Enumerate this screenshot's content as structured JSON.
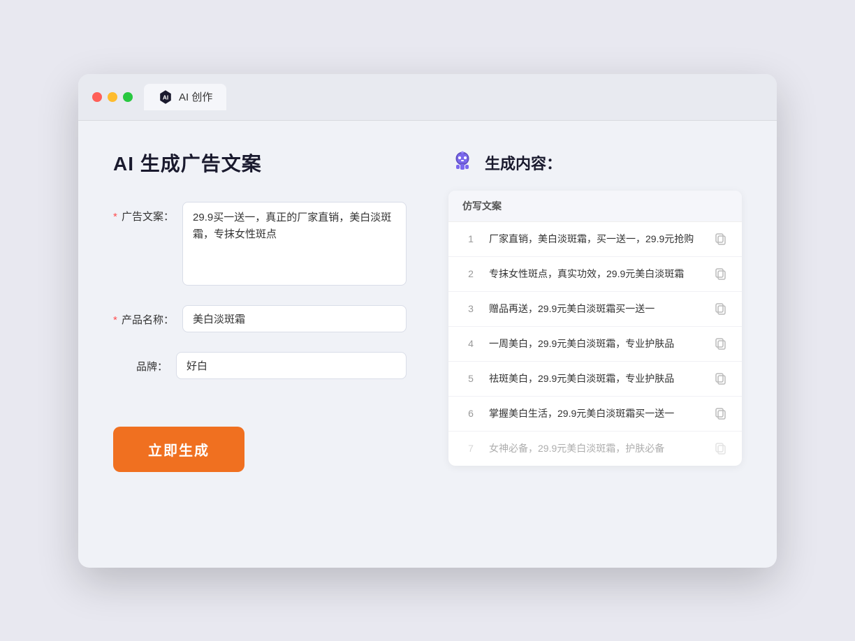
{
  "window": {
    "tab_label": "AI 创作",
    "traffic_lights": [
      "red",
      "yellow",
      "green"
    ]
  },
  "left_panel": {
    "title": "AI 生成广告文案",
    "fields": [
      {
        "label": "广告文案：",
        "required": true,
        "type": "textarea",
        "value": "29.9买一送一，真正的厂家直销，美白淡斑霜，专抹女性斑点",
        "name": "ad-copy-input"
      },
      {
        "label": "产品名称：",
        "required": true,
        "type": "text",
        "value": "美白淡斑霜",
        "name": "product-name-input"
      },
      {
        "label": "品牌：",
        "required": false,
        "type": "text",
        "value": "好白",
        "name": "brand-input"
      }
    ],
    "generate_button": "立即生成"
  },
  "right_panel": {
    "title": "生成内容：",
    "column_header": "仿写文案",
    "results": [
      {
        "id": 1,
        "text": "厂家直销，美白淡斑霜，买一送一，29.9元抢购",
        "faded": false
      },
      {
        "id": 2,
        "text": "专抹女性斑点，真实功效，29.9元美白淡斑霜",
        "faded": false
      },
      {
        "id": 3,
        "text": "赠品再送，29.9元美白淡斑霜买一送一",
        "faded": false
      },
      {
        "id": 4,
        "text": "一周美白，29.9元美白淡斑霜，专业护肤品",
        "faded": false
      },
      {
        "id": 5,
        "text": "祛斑美白，29.9元美白淡斑霜，专业护肤品",
        "faded": false
      },
      {
        "id": 6,
        "text": "掌握美白生活，29.9元美白淡斑霜买一送一",
        "faded": false
      },
      {
        "id": 7,
        "text": "女神必备，29.9元美白淡斑霜，护肤必备",
        "faded": true
      }
    ]
  }
}
